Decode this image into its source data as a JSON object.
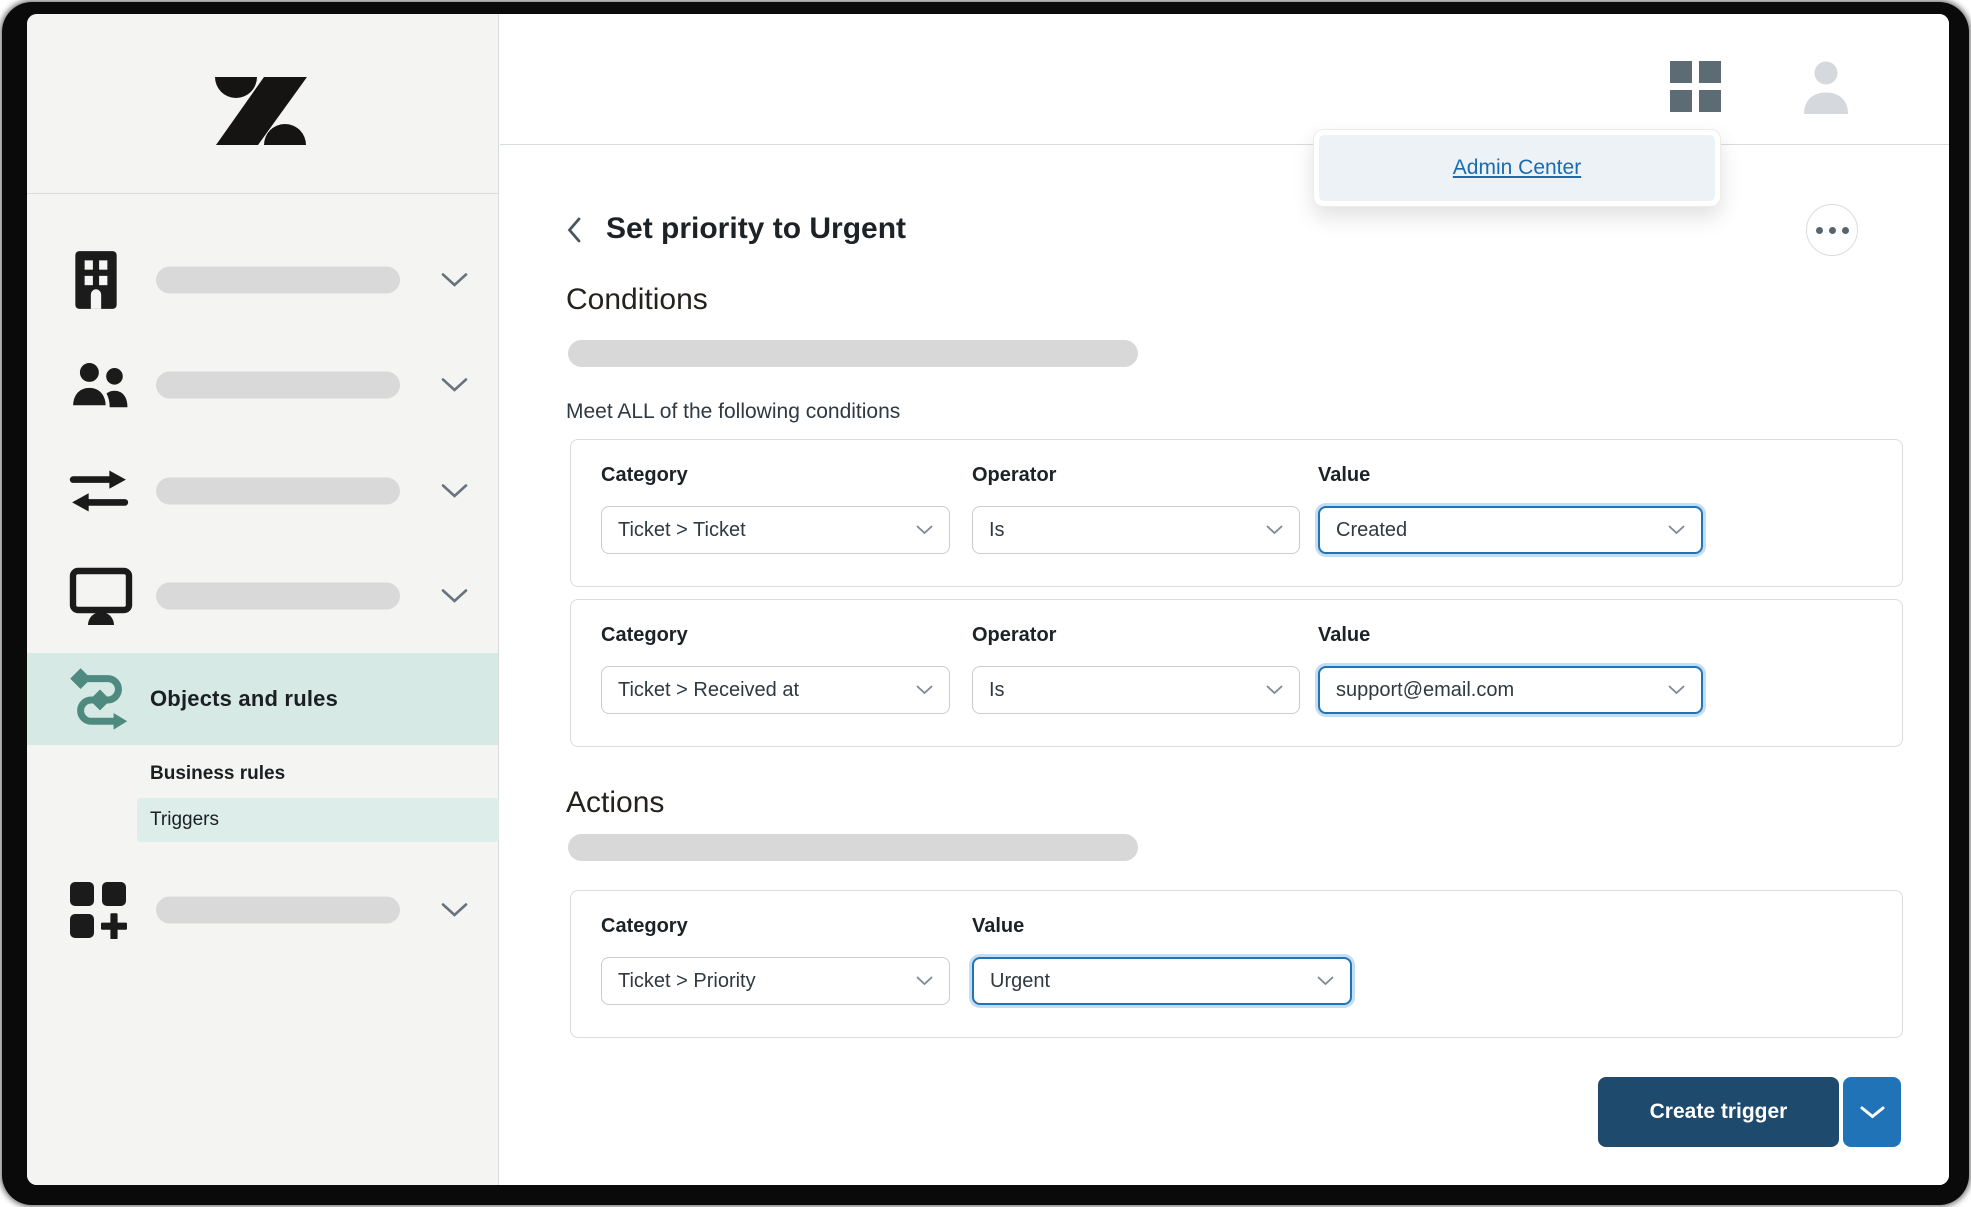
{
  "colors": {
    "accent_teal": "#4e8a7f",
    "selected_nav_bg": "#d6e9e4",
    "sub_nav_selected_bg": "#ddeeea",
    "focus_blue": "#1f73b7",
    "link_blue": "#1a6bb0",
    "button_navy": "#1e4a6d",
    "button_blue": "#2073b7",
    "sidebar_bg": "#f4f4f2"
  },
  "icons": {
    "logo": "zendesk-logo",
    "nav": [
      "building-icon",
      "people-icon",
      "transfer-arrows-icon",
      "monitor-icon",
      "workflow-path-icon",
      "apps-plus-icon"
    ],
    "header": [
      "grid-icon",
      "avatar-icon"
    ],
    "misc": [
      "kebab-icon",
      "back-chevron-icon",
      "chevron-down-icon"
    ]
  },
  "sidebar": {
    "objects_and_rules": "Objects and rules",
    "business_rules": "Business rules",
    "triggers": "Triggers"
  },
  "header": {
    "admin_center_link": "Admin Center"
  },
  "page": {
    "title": "Set priority to Urgent",
    "conditions_heading": "Conditions",
    "conditions_subheading": "Meet ALL of the following conditions",
    "actions_heading": "Actions"
  },
  "labels": {
    "category": "Category",
    "operator": "Operator",
    "value": "Value"
  },
  "conditions": [
    {
      "category": "Ticket > Ticket",
      "operator": "Is",
      "value": "Created"
    },
    {
      "category": "Ticket > Received at",
      "operator": "Is",
      "value": "support@email.com"
    }
  ],
  "actions": [
    {
      "category": "Ticket > Priority",
      "value": "Urgent"
    }
  ],
  "footer": {
    "create_trigger": "Create trigger"
  }
}
